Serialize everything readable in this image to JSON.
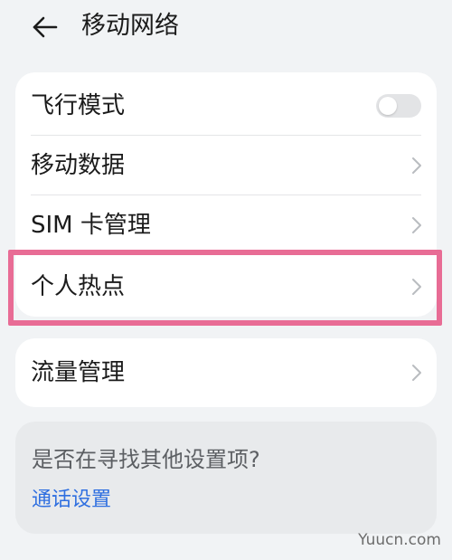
{
  "header": {
    "back_icon": "arrow-left-icon",
    "title": "移动网络"
  },
  "settings": {
    "airplane_mode": {
      "label": "飞行模式",
      "enabled": false,
      "icon": "toggle-switch"
    },
    "mobile_data": {
      "label": "移动数据",
      "icon": "chevron-right-icon"
    },
    "sim_management": {
      "label": "SIM 卡管理",
      "icon": "chevron-right-icon"
    },
    "hotspot": {
      "label": "个人热点",
      "icon": "chevron-right-icon",
      "highlighted": true,
      "highlight_color": "#e86c95"
    },
    "traffic_management": {
      "label": "流量管理",
      "icon": "chevron-right-icon"
    }
  },
  "suggestion": {
    "question": "是否在寻找其他设置项?",
    "link_label": "通话设置",
    "link_color": "#2f6fe0"
  },
  "watermark": "Yuucn.com",
  "colors": {
    "background": "#f1f3f5",
    "card": "#ffffff",
    "suggestion_card": "#e8eaec",
    "text_primary": "#1b1b1b",
    "text_secondary": "#5c5f63"
  }
}
